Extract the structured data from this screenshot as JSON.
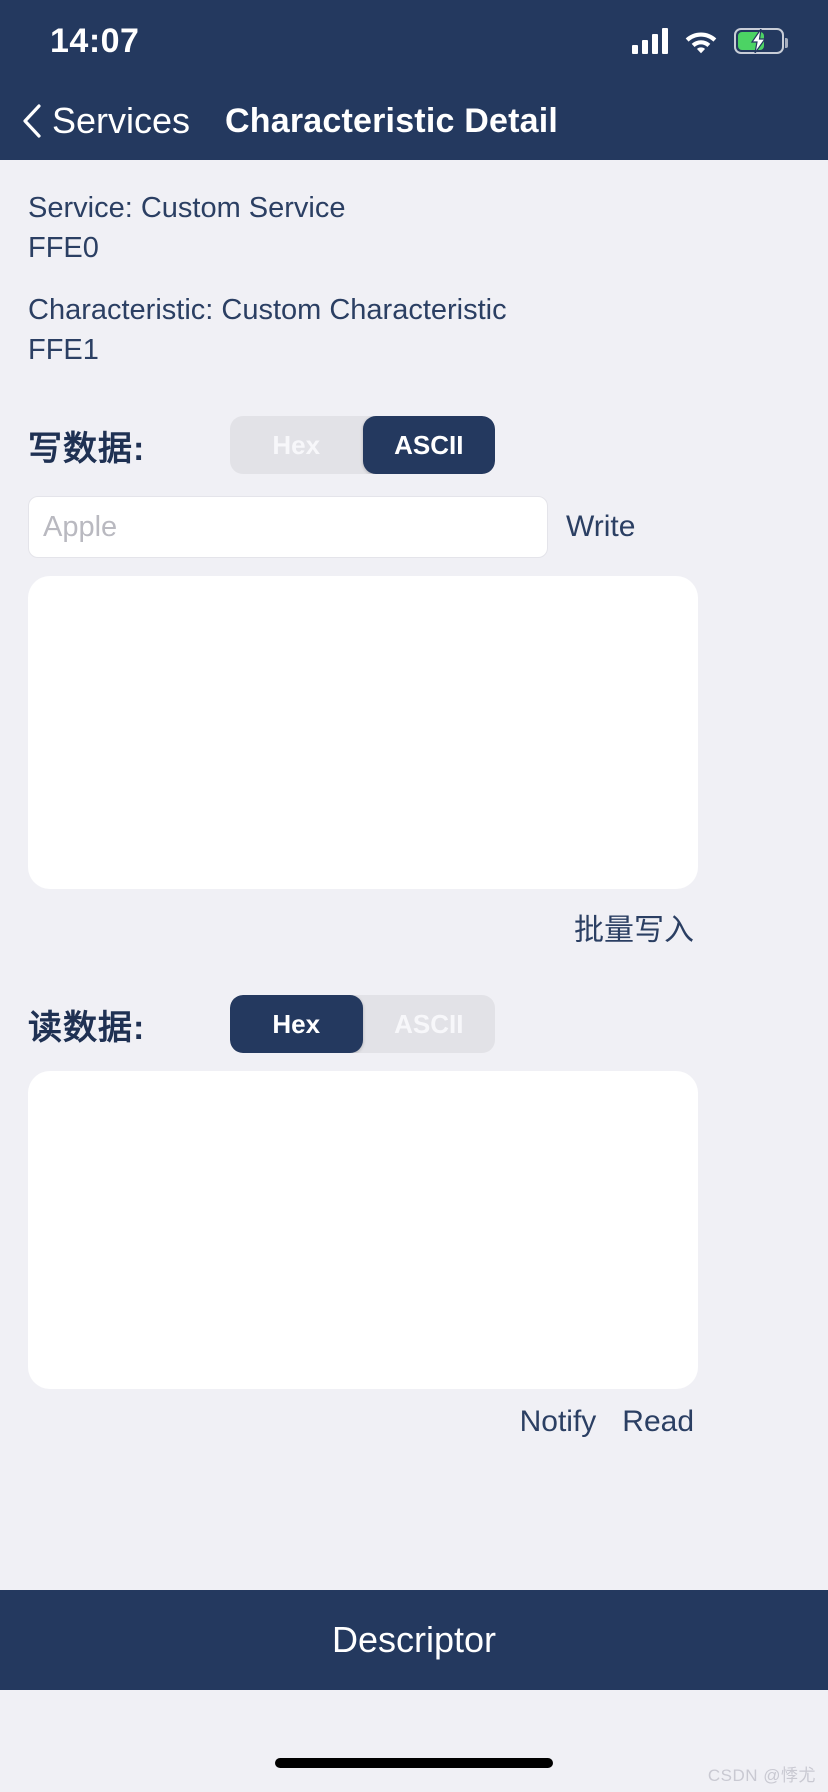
{
  "status_bar": {
    "time": "14:07",
    "signal_icon": "cellular-signal-icon",
    "wifi_icon": "wifi-icon",
    "battery_icon": "battery-charging-icon",
    "battery_level_percent": 62
  },
  "nav_bar": {
    "back_icon": "chevron-left-icon",
    "back_label": "Services",
    "title": "Characteristic Detail"
  },
  "info": {
    "service_line": "Service: Custom Service",
    "service_uuid": "FFE0",
    "characteristic_line": "Characteristic: Custom Characteristic",
    "characteristic_uuid": "FFE1"
  },
  "write_section": {
    "label": "写数据:",
    "format_options": [
      "Hex",
      "ASCII"
    ],
    "format_selected": "ASCII",
    "input_value": "",
    "input_placeholder": "Apple",
    "write_button": "Write",
    "batch_write_button": "批量写入"
  },
  "read_section": {
    "label": "读数据:",
    "format_options": [
      "Hex",
      "ASCII"
    ],
    "format_selected": "Hex",
    "output_value": "",
    "notify_button": "Notify",
    "read_button": "Read"
  },
  "bottom_bar": {
    "descriptor_button": "Descriptor"
  },
  "watermark": "CSDN @悸尤",
  "colors": {
    "navy": "#24395f",
    "page_bg": "#f0f0f5",
    "panel": "#ffffff",
    "segment_track": "#e2e2e7",
    "text_navy": "#2b3f63",
    "battery_green": "#4cd364"
  }
}
